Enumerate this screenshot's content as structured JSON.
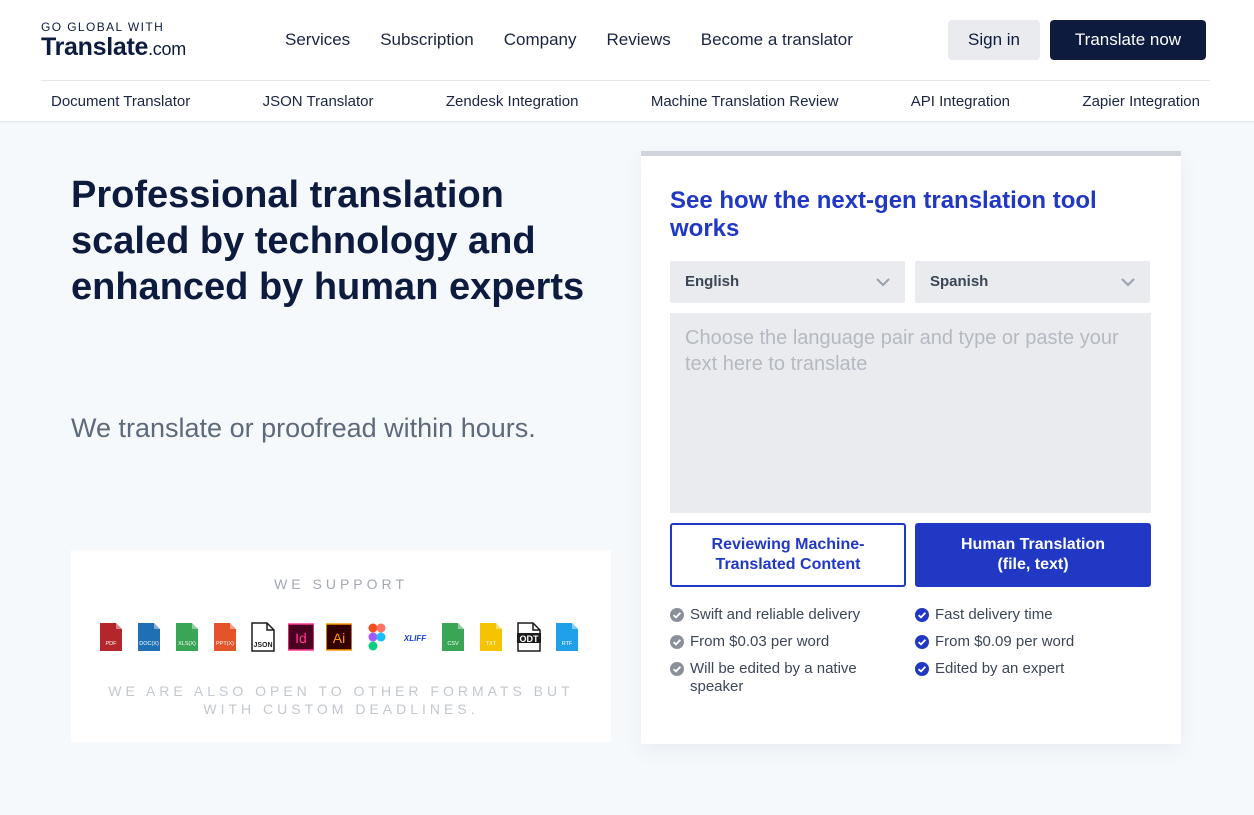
{
  "header": {
    "logo_small": "GO GLOBAL WITH",
    "logo_name": "Translate",
    "logo_suffix": ".com",
    "nav": [
      "Services",
      "Subscription",
      "Company",
      "Reviews",
      "Become a translator"
    ],
    "signin_label": "Sign in",
    "translate_label": "Translate now",
    "subnav": [
      "Document Translator",
      "JSON Translator",
      "Zendesk Integration",
      "Machine Translation Review",
      "API Integration",
      "Zapier Integration"
    ]
  },
  "hero": {
    "title": "Professional translation scaled by technology and enhanced by human experts",
    "subtitle": "We translate or proofread within hours."
  },
  "support": {
    "title": "WE SUPPORT",
    "formats": [
      {
        "name": "pdf-file-icon",
        "label": "PDF",
        "color": "#b3262b"
      },
      {
        "name": "docx-file-icon",
        "label": "DOC(X)",
        "color": "#1f6fb5"
      },
      {
        "name": "xlsx-file-icon",
        "label": "XLS(X)",
        "color": "#3aa655"
      },
      {
        "name": "pptx-file-icon",
        "label": "PPT(X)",
        "color": "#e4542b"
      },
      {
        "name": "json-file-icon",
        "label": "JSON",
        "color": "#1b1b1b"
      },
      {
        "name": "indesign-icon",
        "label": "Id",
        "color": "#ff3a93"
      },
      {
        "name": "illustrator-icon",
        "label": "Ai",
        "color": "#ff9a00"
      },
      {
        "name": "figma-icon",
        "label": "",
        "color": "#a259ff"
      },
      {
        "name": "xliff-icon",
        "label": "XLIFF",
        "color": "#1a3fe0"
      },
      {
        "name": "csv-file-icon",
        "label": "CSV",
        "color": "#3aa655"
      },
      {
        "name": "txt-file-icon",
        "label": "TXT",
        "color": "#f5c400"
      },
      {
        "name": "odt-file-icon",
        "label": "ODT",
        "color": "#1b1b1b"
      },
      {
        "name": "rtf-file-icon",
        "label": "RTF",
        "color": "#1fa0e8"
      }
    ],
    "note": "WE ARE ALSO OPEN TO OTHER FORMATS BUT WITH CUSTOM DEADLINES."
  },
  "widget": {
    "title": "See how the next-gen translation tool works",
    "source_lang": "English",
    "target_lang": "Spanish",
    "placeholder": "Choose the language pair and type or paste your text here to translate",
    "mode_review": "Reviewing Machine-Translated Content",
    "mode_human_line1": "Human Translation",
    "mode_human_line2": "(file, text)",
    "review_features": [
      "Swift and reliable delivery",
      "From $0.03 per word",
      "Will be edited by a native speaker"
    ],
    "human_features": [
      "Fast delivery time",
      "From $0.09 per word",
      "Edited by an expert"
    ]
  },
  "colors": {
    "brand_dark": "#0d1b3e",
    "accent_blue": "#2038c3",
    "check_grey": "#8a9099"
  }
}
